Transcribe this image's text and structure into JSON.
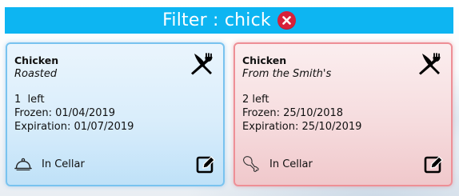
{
  "filter": {
    "text": "Filter : chick",
    "clear_icon": "close-circle-icon",
    "bar_color": "#0db5f2"
  },
  "cards": [
    {
      "name": "Chicken",
      "subtitle": "Roasted",
      "quantity": "1  left",
      "frozen": "Frozen: 01/04/2019",
      "expiration": "Expiration: 01/07/2019",
      "location": "In Cellar",
      "location_icon": "cloche-icon",
      "category_icon": "fork-knife-icon",
      "edit_icon": "edit-icon",
      "status_color": "#79c3ef"
    },
    {
      "name": "Chicken",
      "subtitle": "From the Smith's",
      "quantity": "2 left",
      "frozen": "Frozen: 25/10/2018",
      "expiration": "Expiration: 25/10/2019",
      "location": "In Cellar",
      "location_icon": "drumstick-icon",
      "category_icon": "fork-knife-icon",
      "edit_icon": "edit-icon",
      "status_color": "#ee8f96"
    }
  ]
}
